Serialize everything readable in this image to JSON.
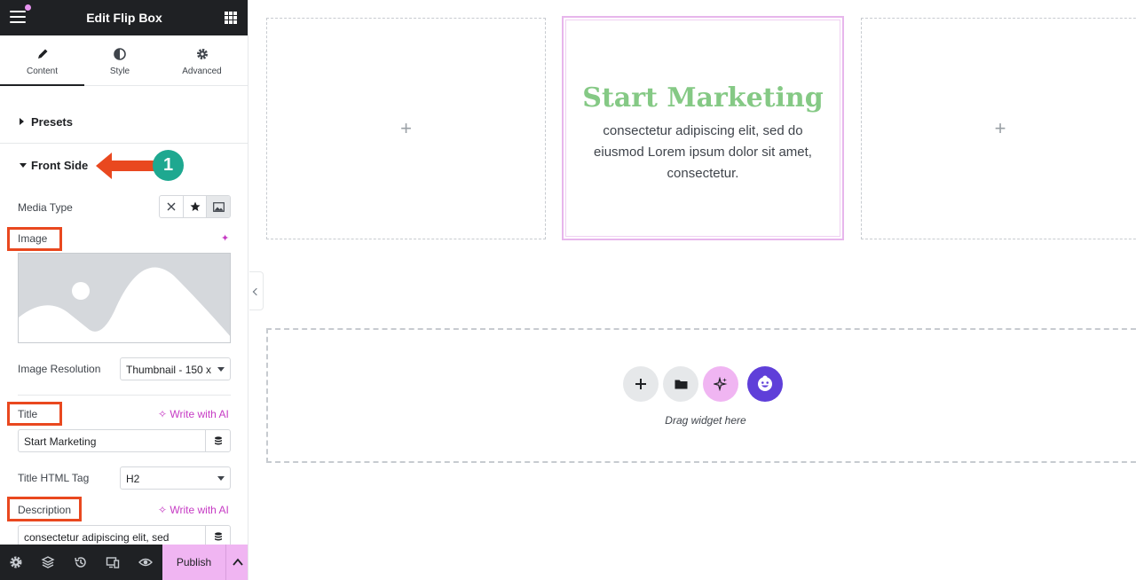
{
  "sidebar": {
    "title": "Edit Flip Box",
    "tabs": [
      {
        "label": "Content"
      },
      {
        "label": "Style"
      },
      {
        "label": "Advanced"
      }
    ],
    "presets_label": "Presets",
    "front_side_label": "Front Side",
    "callout_number": "1",
    "media_type_label": "Media Type",
    "image_label": "Image",
    "image_resolution_label": "Image Resolution",
    "image_resolution_value": "Thumbnail - 150 x",
    "title_label": "Title",
    "write_ai_label": "Write with AI",
    "title_value": "Start Marketing",
    "title_html_tag_label": "Title HTML Tag",
    "title_html_tag_value": "H2",
    "description_label": "Description",
    "description_value": "consectetur adipiscing elit, sed",
    "publish_label": "Publish"
  },
  "canvas": {
    "flip_title": "Start Marketing",
    "flip_description": "consectetur adipiscing elit, sed do eiusmod Lorem ipsum dolor sit amet, consectetur.",
    "plus_symbol": "+",
    "drop_hint": "Drag widget here"
  },
  "colors": {
    "accent_pink": "#f0b5f2",
    "ai_magenta": "#c63bc4",
    "highlight_orange": "#e9481f",
    "callout_teal": "#1ea890",
    "flip_title_green": "#85c985"
  }
}
